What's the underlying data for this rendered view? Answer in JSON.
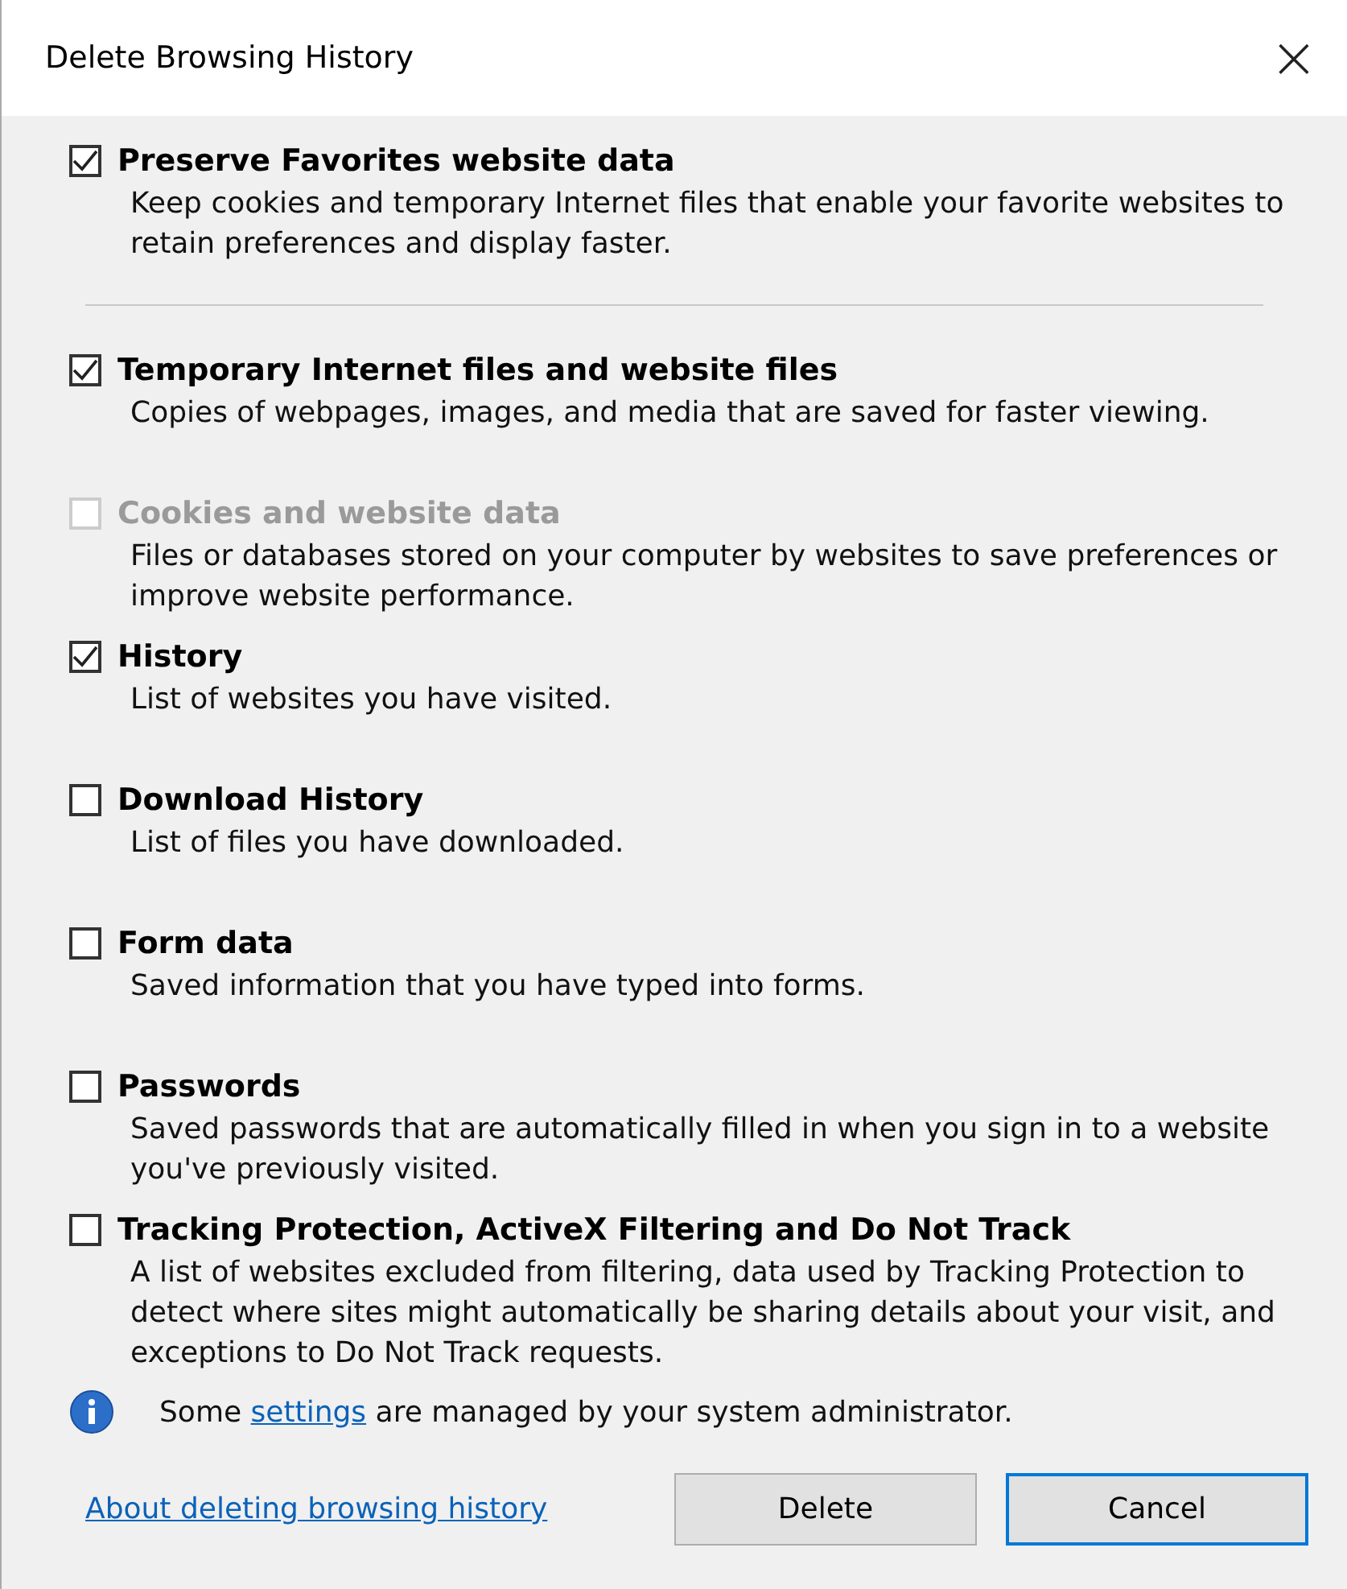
{
  "window": {
    "title": "Delete Browsing History",
    "close": "×"
  },
  "preserve": {
    "title": "Preserve Favorites website data",
    "description": "Keep cookies and temporary Internet files that enable your favorite websites to retain preferences and display faster.",
    "checked": true,
    "disabled": false
  },
  "items": [
    {
      "title": "Temporary Internet files and website files",
      "description": "Copies of webpages, images, and media that are saved for faster viewing.",
      "checked": true,
      "disabled": false
    },
    {
      "title": "Cookies and website data",
      "description": "Files or databases stored on your computer by websites to save preferences or improve website performance.",
      "checked": false,
      "disabled": true
    },
    {
      "title": "History",
      "description": "List of websites you have visited.",
      "checked": true,
      "disabled": false
    },
    {
      "title": "Download History",
      "description": "List of files you have downloaded.",
      "checked": false,
      "disabled": false
    },
    {
      "title": "Form data",
      "description": "Saved information that you have typed into forms.",
      "checked": false,
      "disabled": false
    },
    {
      "title": "Passwords",
      "description": "Saved passwords that are automatically filled in when you sign in to a website you've previously visited.",
      "checked": false,
      "disabled": false
    },
    {
      "title": "Tracking Protection, ActiveX Filtering and Do Not Track",
      "description": "A list of websites excluded from filtering, data used by Tracking Protection to detect where sites might automatically be sharing details about your visit, and exceptions to Do Not Track requests.",
      "checked": false,
      "disabled": false
    }
  ],
  "notice": {
    "before": "Some ",
    "link": "settings",
    "after": " are managed by your system administrator."
  },
  "footer": {
    "link": "About deleting browsing history",
    "buttons": [
      {
        "label": "Delete",
        "default": false
      },
      {
        "label": "Cancel",
        "default": true
      }
    ]
  }
}
